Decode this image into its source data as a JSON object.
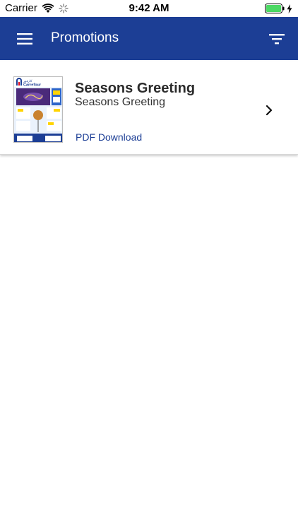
{
  "status_bar": {
    "carrier": "Carrier",
    "time": "9:42 AM",
    "battery_color": "#4cd964"
  },
  "nav": {
    "title": "Promotions",
    "background": "#1c3e95",
    "left_icon": "menu-icon",
    "right_icon": "filter-icon"
  },
  "promotions": [
    {
      "title": "Seasons Greeting",
      "subtitle": "Seasons Greeting",
      "link_label": "PDF Download",
      "thumbnail_brand": "Carrefour",
      "thumbnail_arabic": "كارفور"
    }
  ]
}
